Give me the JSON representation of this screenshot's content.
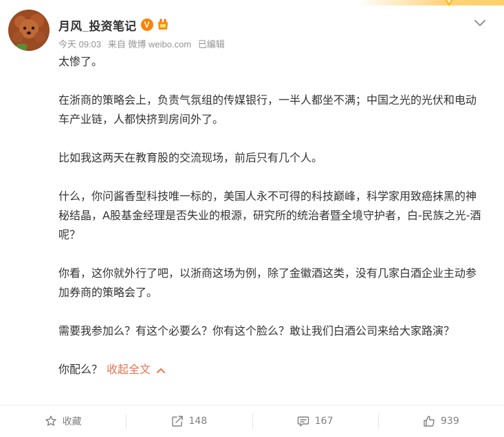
{
  "post": {
    "username": "月风_投资笔记",
    "verified_badge": "V",
    "member_badge_icon": "vip-icon",
    "time": "今天 09:03",
    "source": "来自 微博 weibo.com",
    "edited": "已编辑",
    "paragraphs": [
      "太惨了。",
      "在浙商的策略会上，负责气氛组的传媒银行，一半人都坐不满；中国之光的光伏和电动车产业链，人都快挤到房间外了。",
      "比如我这两天在教育股的交流现场，前后只有几个人。",
      "什么，你问酱香型科技唯一标的，美国人永不可得的科技巅峰，科学家用致癌抹黑的神秘结晶，A股基金经理是否失业的根源，研究所的统治者暨全境守护者，白-民族之光-酒呢？",
      "你看，这你就外行了吧，以浙商这场为例，除了金徽酒这类，没有几家白酒企业主动参加券商的策略会了。",
      "需要我参加么？有这个必要么？你有这个脸么？敢让我们白酒公司来给大家路演？"
    ],
    "last_line": "你配么？",
    "collapse_label": "收起全文"
  },
  "actions": {
    "favorite_label": "收藏",
    "repost_count": "148",
    "comment_count": "167",
    "like_count": "939"
  },
  "colors": {
    "accent": "#eb7350",
    "verified": "#ff8200",
    "meta": "#939393",
    "text": "#333333"
  }
}
